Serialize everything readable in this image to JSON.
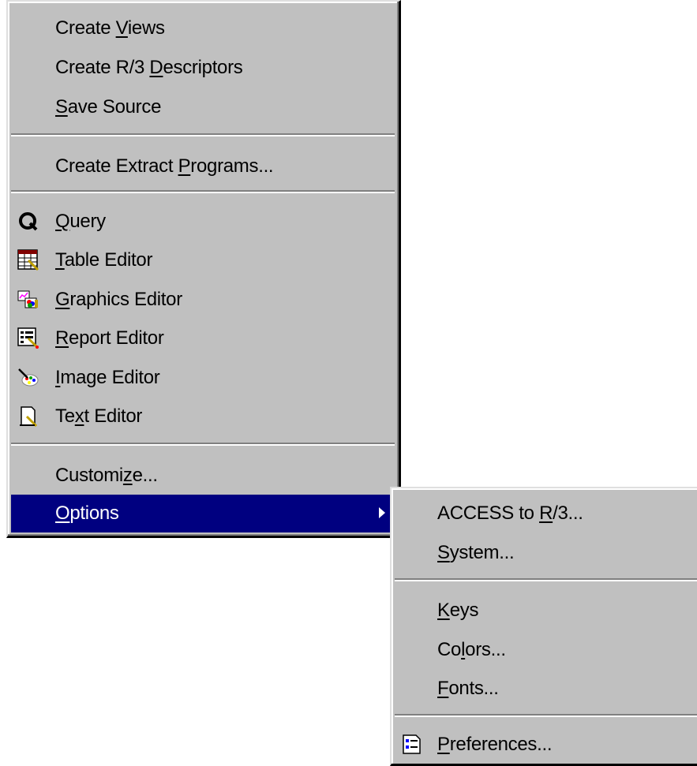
{
  "main_menu": {
    "items": [
      {
        "pre": "Create ",
        "key": "V",
        "post": "iews"
      },
      {
        "pre": "Create R/3 ",
        "key": "D",
        "post": "escriptors"
      },
      {
        "pre": "",
        "key": "S",
        "post": "ave Source"
      },
      {
        "pre": "Create Extract ",
        "key": "P",
        "post": "rograms..."
      },
      {
        "pre": "",
        "key": "Q",
        "post": "uery",
        "icon": "query-icon"
      },
      {
        "pre": "",
        "key": "T",
        "post": "able Editor",
        "icon": "table-editor-icon"
      },
      {
        "pre": "",
        "key": "G",
        "post": "raphics Editor",
        "icon": "graphics-editor-icon"
      },
      {
        "pre": "",
        "key": "R",
        "post": "eport Editor",
        "icon": "report-editor-icon"
      },
      {
        "pre": "",
        "key": "I",
        "post": "mage Editor",
        "icon": "image-editor-icon"
      },
      {
        "pre": "Te",
        "key": "x",
        "post": "t Editor",
        "icon": "text-editor-icon"
      },
      {
        "pre": "Customi",
        "key": "z",
        "post": "e..."
      },
      {
        "pre": "",
        "key": "O",
        "post": "ptions",
        "highlighted": true,
        "has_submenu": true
      }
    ]
  },
  "sub_menu": {
    "items": [
      {
        "pre": "ACCESS to ",
        "key": "R",
        "post": "/3..."
      },
      {
        "pre": "",
        "key": "S",
        "post": "ystem..."
      },
      {
        "pre": "",
        "key": "K",
        "post": "eys"
      },
      {
        "pre": "Co",
        "key": "l",
        "post": "ors..."
      },
      {
        "pre": "",
        "key": "F",
        "post": "onts..."
      },
      {
        "pre": "",
        "key": "P",
        "post": "references...",
        "icon": "preferences-icon"
      }
    ]
  },
  "colors": {
    "menu_bg": "#c0c0c0",
    "highlight_bg": "#000080",
    "highlight_text": "#ffffff"
  }
}
